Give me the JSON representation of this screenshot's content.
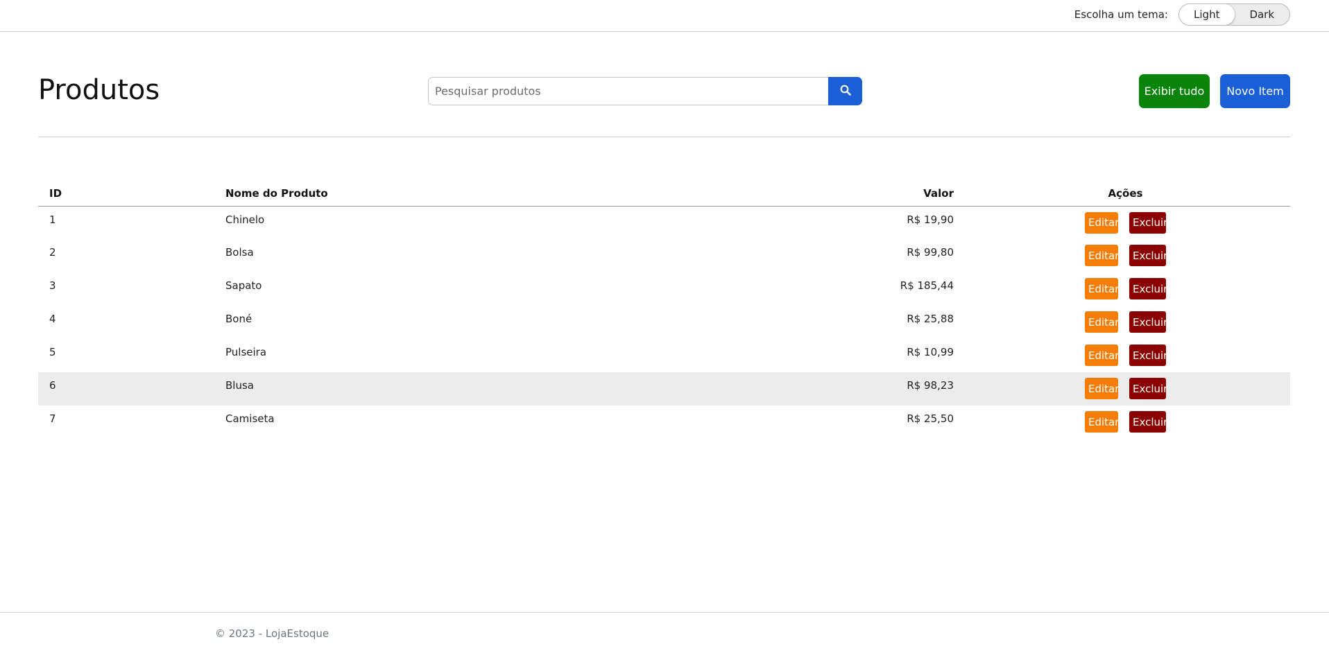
{
  "theme": {
    "label": "Escolha um tema:",
    "options": [
      "Light",
      "Dark"
    ],
    "selected": "Light"
  },
  "header": {
    "title": "Produtos",
    "search_placeholder": "Pesquisar produtos",
    "search_icon": "search-icon",
    "show_all_label": "Exibir tudo",
    "new_item_label": "Novo Item"
  },
  "table": {
    "columns": [
      "ID",
      "Nome do Produto",
      "Valor",
      "Ações"
    ],
    "edit_label": "Editar",
    "delete_label": "Excluir",
    "rows": [
      {
        "id": "1",
        "name": "Chinelo",
        "value": "R$ 19,90"
      },
      {
        "id": "2",
        "name": "Bolsa",
        "value": "R$ 99,80"
      },
      {
        "id": "3",
        "name": "Sapato",
        "value": "R$ 185,44"
      },
      {
        "id": "4",
        "name": "Boné",
        "value": "R$ 25,88"
      },
      {
        "id": "5",
        "name": "Pulseira",
        "value": "R$ 10,99"
      },
      {
        "id": "6",
        "name": "Blusa",
        "value": "R$ 98,23"
      },
      {
        "id": "7",
        "name": "Camiseta",
        "value": "R$ 25,50"
      }
    ]
  },
  "footer": {
    "text": "© 2023 - LojaEstoque"
  },
  "colors": {
    "primary": "#1a5fd6",
    "success": "#0a840a",
    "edit": "#f57c05",
    "delete": "#8b0000",
    "row_highlight": "#ececec"
  }
}
